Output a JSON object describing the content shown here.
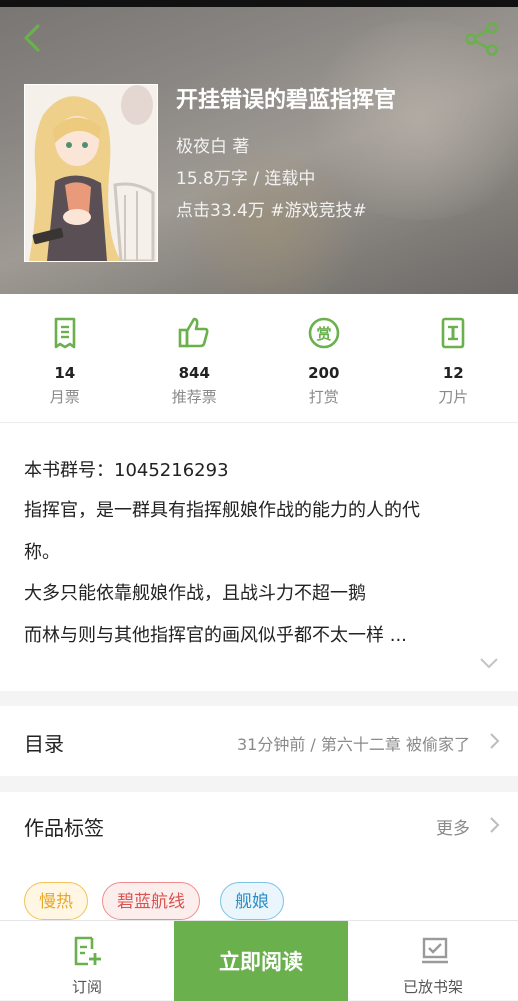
{
  "colors": {
    "accent": "#6ab04c",
    "header_bg": "#9a958f"
  },
  "icons": {
    "back": "chevron-left-icon",
    "share": "share-icon",
    "monthly_ticket": "ticket-icon",
    "recommend": "thumbs-up-icon",
    "tip": "reward-icon",
    "blade": "blade-icon",
    "subscribe": "subscribe-icon",
    "shelf": "bookshelf-icon"
  },
  "book": {
    "title": "开挂错误的碧蓝指挥官",
    "author": "极夜白 著",
    "word_status": "15.8万字 / 连载中",
    "clicks_tag": "点击33.4万 #游戏竞技#"
  },
  "stats": [
    {
      "value": "14",
      "label": "月票"
    },
    {
      "value": "844",
      "label": "推荐票"
    },
    {
      "value": "200",
      "label": "打赏"
    },
    {
      "value": "12",
      "label": "刀片"
    }
  ],
  "intro": {
    "lines": [
      "本书群号：1045216293",
      "指挥官，是一群具有指挥舰娘作战的能力的人的代",
      "称。",
      "大多只能依靠舰娘作战，且战斗力不超一鹅",
      "而林与则与其他指挥官的画风似乎都不太一样 ..."
    ]
  },
  "toc": {
    "title": "目录",
    "latest": "31分钟前 / 第六十二章 被偷家了"
  },
  "tags": {
    "title": "作品标签",
    "more": "更多",
    "items": [
      "慢热",
      "碧蓝航线",
      "舰娘"
    ]
  },
  "bottom": {
    "subscribe": "订阅",
    "read_now": "立即阅读",
    "shelf": "已放书架"
  }
}
